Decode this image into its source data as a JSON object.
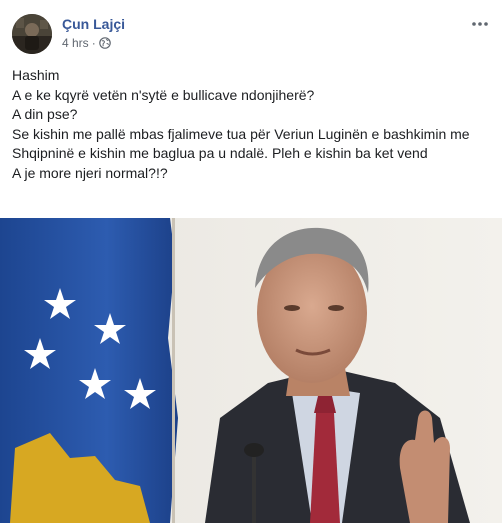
{
  "post": {
    "author": "Çun Lajçi",
    "time": "4 hrs",
    "separator": "·",
    "privacy_icon": "globe-icon",
    "more_icon": "more-options-icon",
    "lines": [
      "Hashim",
      "A e ke kqyrë vetën n'sytë e bullicave ndonjiherë?",
      "A din pse?",
      "Se kishin me pallë mbas fjalimeve tua për Veriun Luginën e bashkimin me",
      "Shqipninë e kishin me baglua pa u ndalë. Pleh e kishin ba ket vend",
      "A je more njeri normal?!?"
    ]
  },
  "colors": {
    "author": "#385898",
    "meta": "#606770",
    "text": "#1c1e21",
    "flag_blue": "#2350a0",
    "flag_gold": "#d7a822",
    "suit": "#2a2c33",
    "tie": "#a22a3a"
  }
}
